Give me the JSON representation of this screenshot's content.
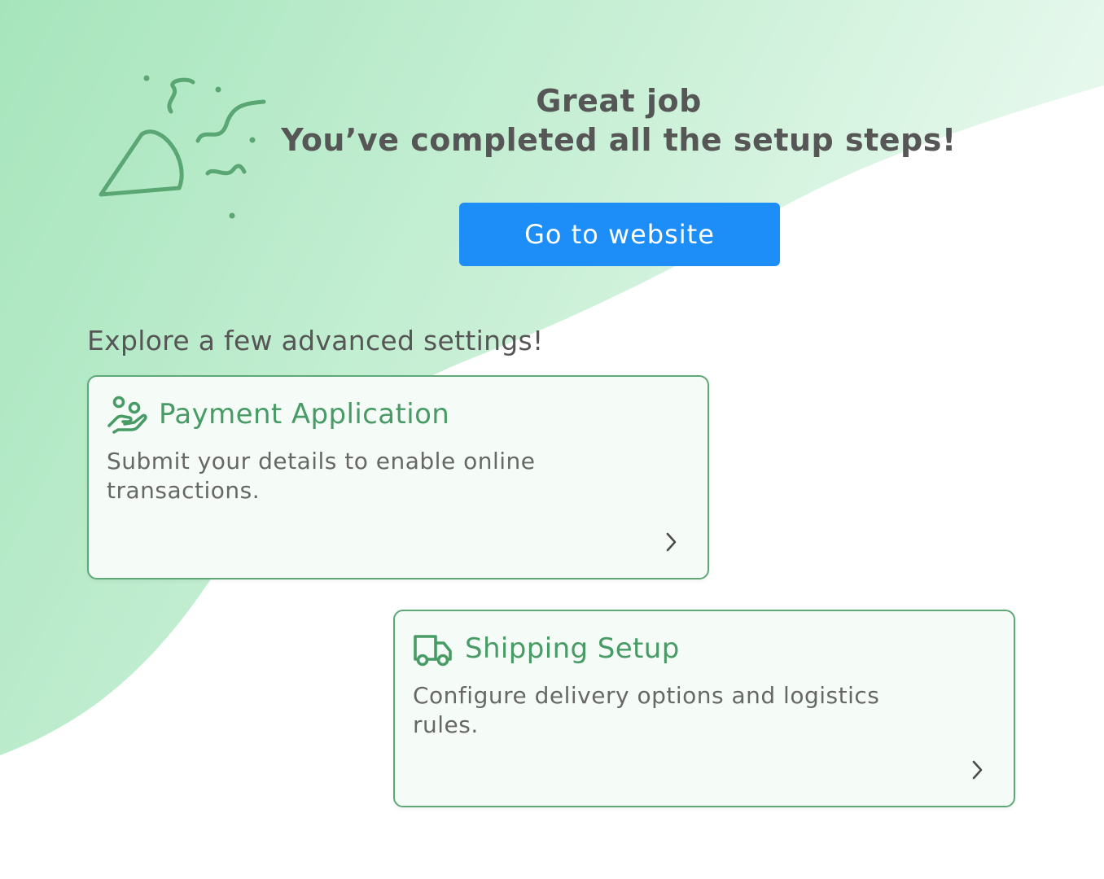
{
  "hero": {
    "title_line1": "Great job",
    "title_line2": "You’ve completed all the setup steps!",
    "cta_label": "Go to website"
  },
  "advanced": {
    "heading": "Explore a few advanced settings!",
    "cards": [
      {
        "title": "Payment Application",
        "description": "Submit your details to enable online transactions.",
        "icon": "hand-coins-icon"
      },
      {
        "title": "Shipping Setup",
        "description": "Configure delivery options and logistics rules.",
        "icon": "truck-icon"
      }
    ]
  },
  "colors": {
    "accent_green": "#489b65",
    "card_border": "#5fa877",
    "card_bg": "#f5fcf7",
    "button_blue": "#1d8ef7",
    "background_gradient": [
      "#a8e6bd",
      "#e9f9ef"
    ],
    "text_dark": "#565656"
  }
}
